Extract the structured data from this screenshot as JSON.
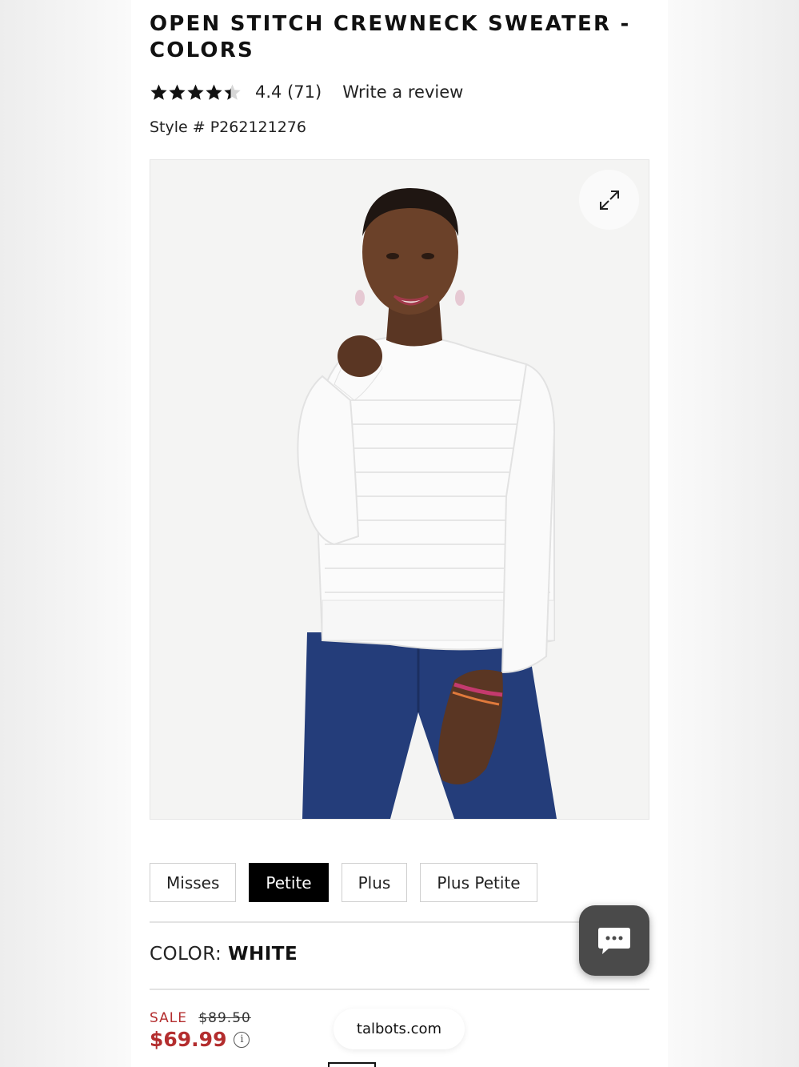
{
  "product": {
    "title": "OPEN STITCH CREWNECK SWEATER - COLORS",
    "rating_value": 4.4,
    "rating_text": "4.4 (71)",
    "review_link": "Write a review",
    "style_number": "Style # P262121276"
  },
  "fits": [
    {
      "label": "Misses",
      "selected": false
    },
    {
      "label": "Petite",
      "selected": true
    },
    {
      "label": "Plus",
      "selected": false
    },
    {
      "label": "Plus Petite",
      "selected": false
    }
  ],
  "color": {
    "label": "COLOR:",
    "value": "WHITE"
  },
  "price": {
    "sale_label": "SALE",
    "original": "$89.50",
    "current": "$69.99"
  },
  "browser": {
    "url": "talbots.com"
  },
  "icons": {
    "expand": "expand-icon",
    "chat": "chat-bubble-icon",
    "info": "info-icon",
    "star": "star-icon"
  },
  "colors": {
    "sale_red": "#b32d2e",
    "selected_fit_bg": "#000000",
    "chat_button_bg": "#4a4a4a"
  }
}
